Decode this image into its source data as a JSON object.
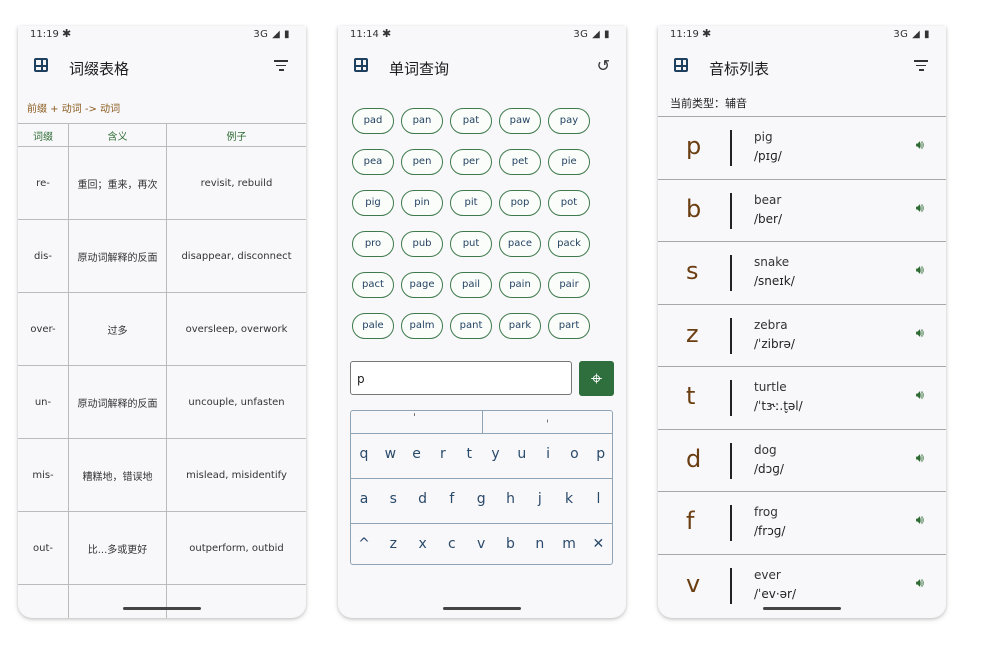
{
  "phone1": {
    "status": {
      "time": "11:19",
      "network": "3G"
    },
    "title": "词缀表格",
    "breadcrumb": "前缀 + 动词 -> 动词",
    "headers": [
      "词缀",
      "含义",
      "例子"
    ],
    "rows": [
      {
        "affix": "re-",
        "meaning": "重回；重来，再次",
        "example": "revisit, rebuild"
      },
      {
        "affix": "dis-",
        "meaning": "原动词解释的反面",
        "example": "disappear, disconnect"
      },
      {
        "affix": "over-",
        "meaning": "过多",
        "example": "oversleep, overwork"
      },
      {
        "affix": "un-",
        "meaning": "原动词解释的反面",
        "example": "uncouple, unfasten"
      },
      {
        "affix": "mis-",
        "meaning": "糟糕地，错误地",
        "example": "mislead, misidentify"
      },
      {
        "affix": "out-",
        "meaning": "比...多或更好",
        "example": "outperform, outbid"
      },
      {
        "affix": "",
        "meaning": "",
        "example": ""
      }
    ]
  },
  "phone2": {
    "status": {
      "time": "11:14",
      "network": "3G"
    },
    "title": "单词查询",
    "chips": [
      "pad",
      "pan",
      "pat",
      "paw",
      "pay",
      "pea",
      "pen",
      "per",
      "pet",
      "pie",
      "pig",
      "pin",
      "pit",
      "pop",
      "pot",
      "pro",
      "pub",
      "put",
      "pace",
      "pack",
      "pact",
      "page",
      "pail",
      "pain",
      "pair",
      "pale",
      "palm",
      "pant",
      "park",
      "part"
    ],
    "input_value": "p",
    "keyboard": {
      "top": [
        "ˈ",
        "ˌ"
      ],
      "row1": [
        "q",
        "w",
        "e",
        "r",
        "t",
        "y",
        "u",
        "i",
        "o",
        "p"
      ],
      "row2": [
        "a",
        "s",
        "d",
        "f",
        "g",
        "h",
        "j",
        "k",
        "l"
      ],
      "row3": [
        "^",
        "z",
        "x",
        "c",
        "v",
        "b",
        "n",
        "m",
        "✕"
      ]
    }
  },
  "phone3": {
    "status": {
      "time": "11:19",
      "network": "3G"
    },
    "title": "音标列表",
    "type_label": "当前类型：辅音",
    "phonemes": [
      {
        "symbol": "p",
        "word": "pig",
        "ipa": "/pɪɡ/"
      },
      {
        "symbol": "b",
        "word": "bear",
        "ipa": "/ber/"
      },
      {
        "symbol": "s",
        "word": "snake",
        "ipa": "/sneɪk/"
      },
      {
        "symbol": "z",
        "word": "zebra",
        "ipa": "/ˈzibrə/"
      },
      {
        "symbol": "t",
        "word": "turtle",
        "ipa": "/ˈtɝː.t̬əl/"
      },
      {
        "symbol": "d",
        "word": "dog",
        "ipa": "/dɔɡ/"
      },
      {
        "symbol": "f",
        "word": "frog",
        "ipa": "/frɔɡ/"
      },
      {
        "symbol": "v",
        "word": "ever",
        "ipa": "/ˈev·ər/"
      }
    ]
  },
  "colors": {
    "accent_green": "#2f6e3d",
    "brown": "#6b3e12",
    "navy": "#1f3f5f"
  }
}
